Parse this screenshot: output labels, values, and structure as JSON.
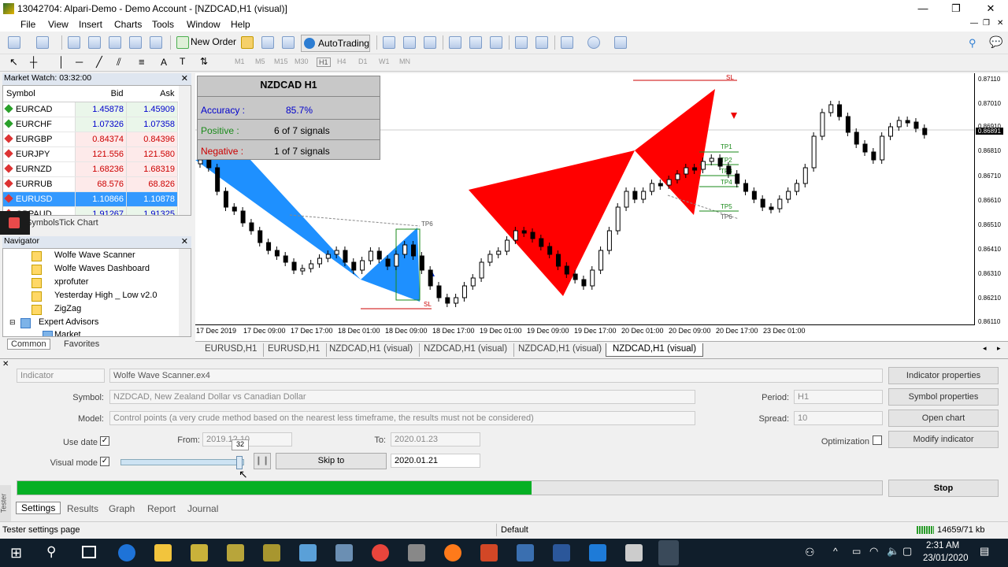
{
  "window": {
    "title": "13042704: Alpari-Demo - Demo Account - [NZDCAD,H1 (visual)]",
    "min": "—",
    "max": "❐",
    "close": "✕"
  },
  "menu": [
    "File",
    "View",
    "Insert",
    "Charts",
    "Tools",
    "Window",
    "Help"
  ],
  "toolbar": {
    "new_order": "New Order",
    "autotrading": "AutoTrading"
  },
  "timeframes": [
    "M1",
    "M5",
    "M15",
    "M30",
    "H1",
    "H4",
    "D1",
    "W1",
    "MN"
  ],
  "market_watch": {
    "title": "Market Watch: 03:32:00",
    "cols": [
      "Symbol",
      "Bid",
      "Ask"
    ],
    "rows": [
      [
        "EURCAD",
        "1.45878",
        "1.45909"
      ],
      [
        "EURCHF",
        "1.07326",
        "1.07358"
      ],
      [
        "EURGBP",
        "0.84374",
        "0.84396"
      ],
      [
        "EURJPY",
        "121.556",
        "121.580"
      ],
      [
        "EURNZD",
        "1.68236",
        "1.68319"
      ],
      [
        "EURRUB",
        "68.576",
        "68.826"
      ],
      [
        "EURUSD",
        "1.10866",
        "1.10878"
      ],
      [
        "GBPAUD",
        "1.91267",
        "1.91325"
      ]
    ],
    "tabs": [
      "Symbols",
      "Tick Chart"
    ]
  },
  "navigator": {
    "title": "Navigator",
    "items": [
      "Wolfe Wave Scanner",
      "Wolfe Waves Dashboard",
      "xprofuter",
      "Yesterday High _ Low v2.0",
      "ZigZag",
      "Expert Advisors",
      "Market"
    ],
    "tabs": [
      "Common",
      "Favorites"
    ]
  },
  "chart": {
    "symbol": "NZDCAD  H1",
    "accuracy_label": "Accuracy  :",
    "accuracy": "85.7%",
    "positive_label": "Positive     :",
    "positive": "6 of 7 signals",
    "negative_label": "Negative    :",
    "negative": "1 of 7 signals",
    "prices": [
      "0.87110",
      "0.87010",
      "0.86910",
      "0.86810",
      "0.86710",
      "0.86610",
      "0.86510",
      "0.86410",
      "0.86310",
      "0.86210",
      "0.86110"
    ],
    "current_price": "0.86891",
    "dates": [
      "17 Dec 2019",
      "17 Dec 09:00",
      "17 Dec 17:00",
      "18 Dec 01:00",
      "18 Dec 09:00",
      "18 Dec 17:00",
      "19 Dec 01:00",
      "19 Dec 09:00",
      "19 Dec 17:00",
      "20 Dec 01:00",
      "20 Dec 09:00",
      "20 Dec 17:00",
      "23 Dec 01:00"
    ],
    "tp_labels": [
      "TP1",
      "TP2",
      "TP3",
      "TP4",
      "TP5",
      "TP6",
      "SL"
    ],
    "tabs": [
      "EURUSD,H1",
      "EURUSD,H1",
      "NZDCAD,H1 (visual)",
      "NZDCAD,H1 (visual)",
      "NZDCAD,H1 (visual)",
      "NZDCAD,H1 (visual)"
    ]
  },
  "tester": {
    "type": "Indicator",
    "file": "Wolfe Wave Scanner.ex4",
    "symbol_label": "Symbol:",
    "symbol": "NZDCAD, New Zealand Dollar vs Canadian Dollar",
    "model_label": "Model:",
    "model": "Control points (a very crude method based on the nearest less timeframe, the results must not be considered)",
    "use_date": "Use date",
    "from_label": "From:",
    "from": "2019.12.10",
    "to_label": "To:",
    "to": "2020.01.23",
    "visual_mode": "Visual mode",
    "speed": "32",
    "skip_to": "Skip to",
    "skip_date": "2020.01.21",
    "period_label": "Period:",
    "period": "H1",
    "spread_label": "Spread:",
    "spread": "10",
    "optimization": "Optimization",
    "progress": 0.595,
    "buttons": [
      "Indicator properties",
      "Symbol properties",
      "Open chart",
      "Modify indicator"
    ],
    "stop": "Stop",
    "tabs": [
      "Settings",
      "Results",
      "Graph",
      "Report",
      "Journal"
    ],
    "side": "Tester"
  },
  "status": {
    "left": "Tester settings page",
    "profile": "Default",
    "traffic": "14659/71 kb"
  },
  "tray": {
    "time": "2:31 AM",
    "date": "23/01/2020"
  }
}
